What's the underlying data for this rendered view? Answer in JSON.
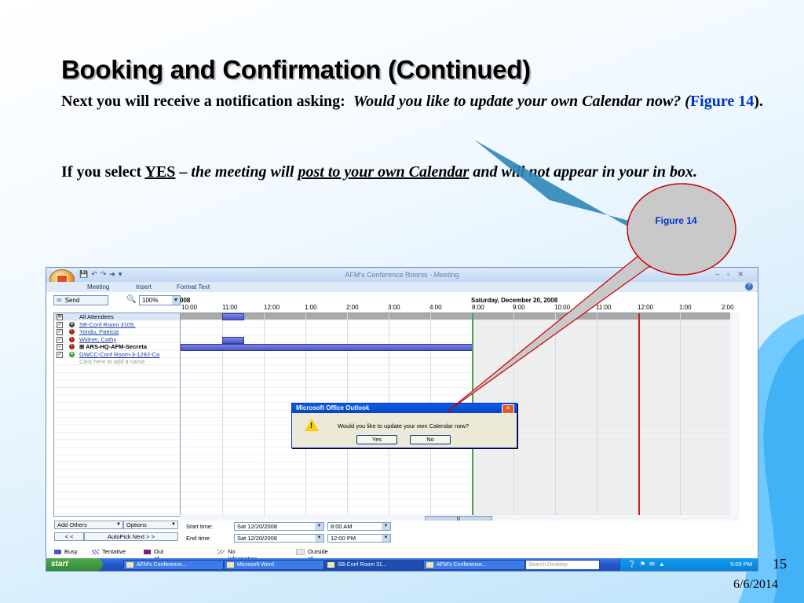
{
  "slide": {
    "title": "Booking and Confirmation (Continued)",
    "p1_lead": "Next you will receive a notification asking:",
    "p1_question": "Would you like to update your own Calendar now? (",
    "p1_figure_ref": "Figure 14",
    "p1_tail": ").",
    "p2_lead": "If you select",
    "p2_yes": "YES",
    "p2_dash": "–",
    "p2_italic1": "the meeting will",
    "p2_italic_underlined": "post to your own Calendar",
    "p2_tail": "and will not appear in your in box.",
    "callout_label": "Figure 14",
    "slide_number": "15",
    "date": "6/6/2014",
    "accent_color": "#0033cc"
  },
  "window": {
    "title": "AFM's Conference Rooms - Meeting",
    "tabs": [
      "Meeting",
      "Insert",
      "Format Text"
    ]
  },
  "toolbar": {
    "send_label": "Send",
    "zoom_value": "100%",
    "date_left": "008",
    "date_right": "Saturday, December 20, 2008",
    "times": [
      "10:00",
      "11:00",
      "12:00",
      "1:00",
      "2:00",
      "3:00",
      "4:00",
      "8:00",
      "9:00",
      "10:00",
      "11:00",
      "12:00",
      "1:00",
      "2:00"
    ]
  },
  "attendees": {
    "header": "All Attendees",
    "rows": [
      {
        "name": "SB-Conf Room 3109,",
        "role": "k",
        "style": "link"
      },
      {
        "name": "Yondu, Patricia",
        "role": "r",
        "style": "link"
      },
      {
        "name": "Widner, Cathy",
        "role": "r",
        "style": "link"
      },
      {
        "name": "ARS-HQ-AFM-Secreta",
        "role": "r",
        "style": "bold",
        "prefix": "⊞"
      },
      {
        "name": "GWCC-Conf Room-3-1292-Ca",
        "role": "g",
        "style": "link"
      }
    ],
    "add_hint": "Click here to add a name"
  },
  "bottom": {
    "add_others": "Add Others",
    "options": "Options",
    "prev": "< <",
    "autopick": "AutoPick Next > >",
    "start_label": "Start time:",
    "end_label": "End time:",
    "start_date": "Sat 12/20/2008",
    "start_time": "8:00 AM",
    "end_date": "Sat 12/20/2008",
    "end_time": "12:00 PM",
    "legend": [
      "Busy",
      "Tentative",
      "Out of Office",
      "No Information",
      "Outside of working hours"
    ]
  },
  "taskbar": {
    "start": "start",
    "items": [
      "AFM's Conference...",
      "Microsoft Word",
      "SB-Conf Room 31...",
      "AFM's Conference..."
    ],
    "search": "Search Desktop",
    "clock": "5:05 PM"
  },
  "dialog": {
    "title": "Microsoft Office Outlook",
    "message": "Would you like to update your own Calendar now?",
    "yes": "Yes",
    "no": "No"
  }
}
